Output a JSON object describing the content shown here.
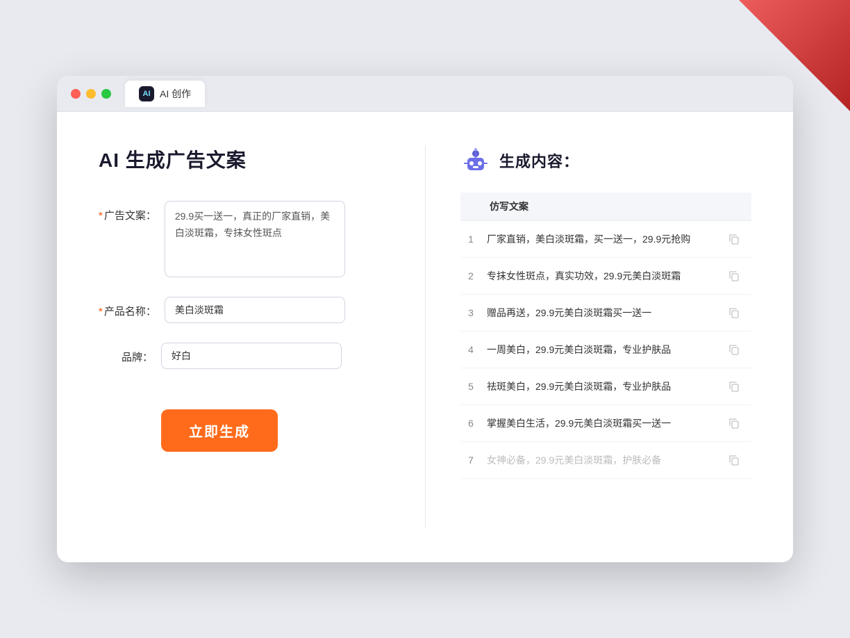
{
  "window": {
    "tab_label": "AI 创作"
  },
  "page": {
    "title": "AI 生成广告文案"
  },
  "form": {
    "ad_copy_label": "广告文案：",
    "ad_copy_required": "*",
    "ad_copy_value": "29.9买一送一，真正的厂家直销，美白淡斑霜，专抹女性斑点",
    "product_name_label": "产品名称：",
    "product_name_required": "*",
    "product_name_value": "美白淡斑霜",
    "brand_label": "品牌：",
    "brand_value": "好白",
    "generate_button_label": "立即生成"
  },
  "result": {
    "header_label": "生成内容：",
    "column_header": "仿写文案",
    "items": [
      {
        "num": "1",
        "text": "厂家直销，美白淡斑霜，买一送一，29.9元抢购",
        "faded": false
      },
      {
        "num": "2",
        "text": "专抹女性斑点，真实功效，29.9元美白淡斑霜",
        "faded": false
      },
      {
        "num": "3",
        "text": "赠品再送，29.9元美白淡斑霜买一送一",
        "faded": false
      },
      {
        "num": "4",
        "text": "一周美白，29.9元美白淡斑霜，专业护肤品",
        "faded": false
      },
      {
        "num": "5",
        "text": "祛斑美白，29.9元美白淡斑霜，专业护肤品",
        "faded": false
      },
      {
        "num": "6",
        "text": "掌握美白生活，29.9元美白淡斑霜买一送一",
        "faded": false
      },
      {
        "num": "7",
        "text": "女神必备，29.9元美白淡斑霜，护肤必备",
        "faded": true
      }
    ]
  }
}
